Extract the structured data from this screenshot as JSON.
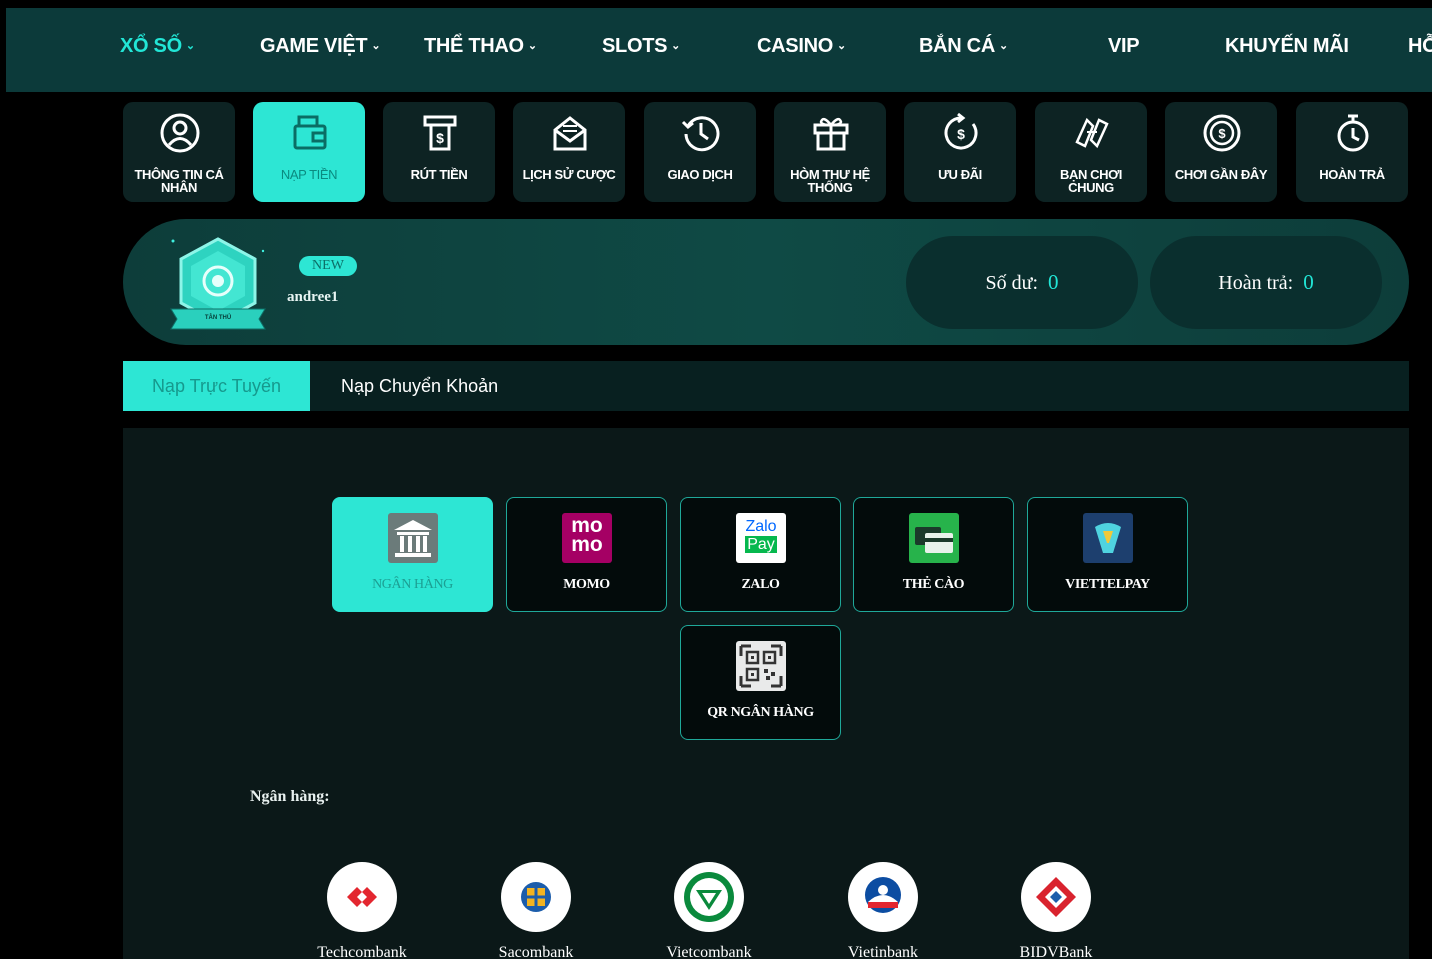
{
  "nav": {
    "items": [
      {
        "label": "XỔ SỐ",
        "caret": "⌄",
        "active": true
      },
      {
        "label": "GAME VIỆT",
        "caret": "⌄"
      },
      {
        "label": "THỂ THAO",
        "caret": "⌄"
      },
      {
        "label": "SLOTS",
        "caret": "⌄"
      },
      {
        "label": "CASINO",
        "caret": "⌄"
      },
      {
        "label": "BẮN CÁ",
        "caret": "⌄"
      },
      {
        "label": "VIP",
        "caret": ""
      },
      {
        "label": "KHUYẾN MÃI",
        "caret": ""
      },
      {
        "label": "HỖ",
        "caret": ""
      }
    ]
  },
  "quick_menu": {
    "items": [
      {
        "label": "THÔNG TIN CÁ NHÂN",
        "icon": "user-icon"
      },
      {
        "label": "NẠP TIỀN",
        "icon": "wallet-icon",
        "active": true
      },
      {
        "label": "RÚT TIỀN",
        "icon": "atm-withdraw-icon"
      },
      {
        "label": "LỊCH SỬ CƯỢC",
        "icon": "envelope-history-icon"
      },
      {
        "label": "GIAO DỊCH",
        "icon": "clock-history-icon"
      },
      {
        "label": "HÒM THƯ HỆ THỐNG",
        "icon": "gift-box-icon"
      },
      {
        "label": "ƯU ĐÃI",
        "icon": "dollar-cycle-icon"
      },
      {
        "label": "BẠN CHƠI CHUNG",
        "icon": "handshake-icon"
      },
      {
        "label": "CHƠI GẦN ĐÂY",
        "icon": "coin-icon"
      },
      {
        "label": "HOÀN TRẢ",
        "icon": "stopwatch-icon"
      }
    ]
  },
  "profile": {
    "badge_text": "TÂN THỦ",
    "new_tag": "NEW",
    "username": "andree1",
    "balance_label": "Số dư:",
    "balance_value": "0",
    "rebate_label": "Hoàn trả:",
    "rebate_value": "0"
  },
  "tabs": {
    "online": "Nạp Trực Tuyến",
    "transfer": "Nạp Chuyển Khoản"
  },
  "methods": [
    {
      "label": "NGÂN HÀNG",
      "icon": "bank-icon",
      "active": true
    },
    {
      "label": "MOMO",
      "icon": "momo-icon",
      "logo_top": "mo",
      "logo_bottom": "mo"
    },
    {
      "label": "ZALO",
      "icon": "zalopay-icon",
      "logo_top": "Zalo",
      "logo_bottom": "Pay"
    },
    {
      "label": "THẺ CÀO",
      "icon": "scratch-card-icon"
    },
    {
      "label": "VIETTELPAY",
      "icon": "viettelpay-icon"
    },
    {
      "label": "QR NGÂN HÀNG",
      "icon": "qr-code-icon"
    }
  ],
  "bank_section": {
    "heading": "Ngân hàng:",
    "banks": [
      {
        "name": "Techcombank",
        "icon": "techcombank-logo-icon"
      },
      {
        "name": "Sacombank",
        "icon": "sacombank-logo-icon"
      },
      {
        "name": "Vietcombank",
        "icon": "vietcombank-logo-icon"
      },
      {
        "name": "Vietinbank",
        "icon": "vietinbank-logo-icon"
      },
      {
        "name": "BIDVBank",
        "icon": "bidv-logo-icon"
      }
    ]
  },
  "colors": {
    "accent": "#2de6d4",
    "nav_bg": "#0c3a3a",
    "page_bg": "#000000",
    "panel_bg": "#0b1818"
  }
}
